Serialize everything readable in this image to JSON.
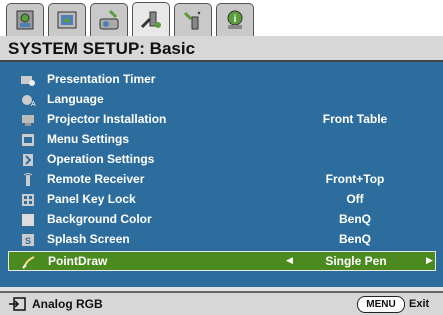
{
  "tabs": [
    {
      "icon": "picture-icon"
    },
    {
      "icon": "display-icon"
    },
    {
      "icon": "system-basic-icon"
    },
    {
      "icon": "system-setup-icon",
      "active": true
    },
    {
      "icon": "advanced-setup-icon"
    },
    {
      "icon": "information-icon"
    }
  ],
  "title": "SYSTEM SETUP: Basic",
  "menu": [
    {
      "label": "Presentation Timer",
      "value": ""
    },
    {
      "label": "Language",
      "value": ""
    },
    {
      "label": "Projector Installation",
      "value": "Front Table"
    },
    {
      "label": "Menu Settings",
      "value": ""
    },
    {
      "label": "Operation Settings",
      "value": ""
    },
    {
      "label": "Remote Receiver",
      "value": "Front+Top"
    },
    {
      "label": "Panel Key Lock",
      "value": "Off"
    },
    {
      "label": "Background Color",
      "value": "BenQ"
    },
    {
      "label": "Splash Screen",
      "value": "BenQ"
    },
    {
      "label": "PointDraw",
      "value": "Single Pen",
      "selected": true
    }
  ],
  "footer": {
    "source": "Analog RGB",
    "menu_button": "MENU",
    "exit": "Exit"
  },
  "colors": {
    "panel": "#2d6d9e",
    "selected": "#4a8a1f"
  }
}
